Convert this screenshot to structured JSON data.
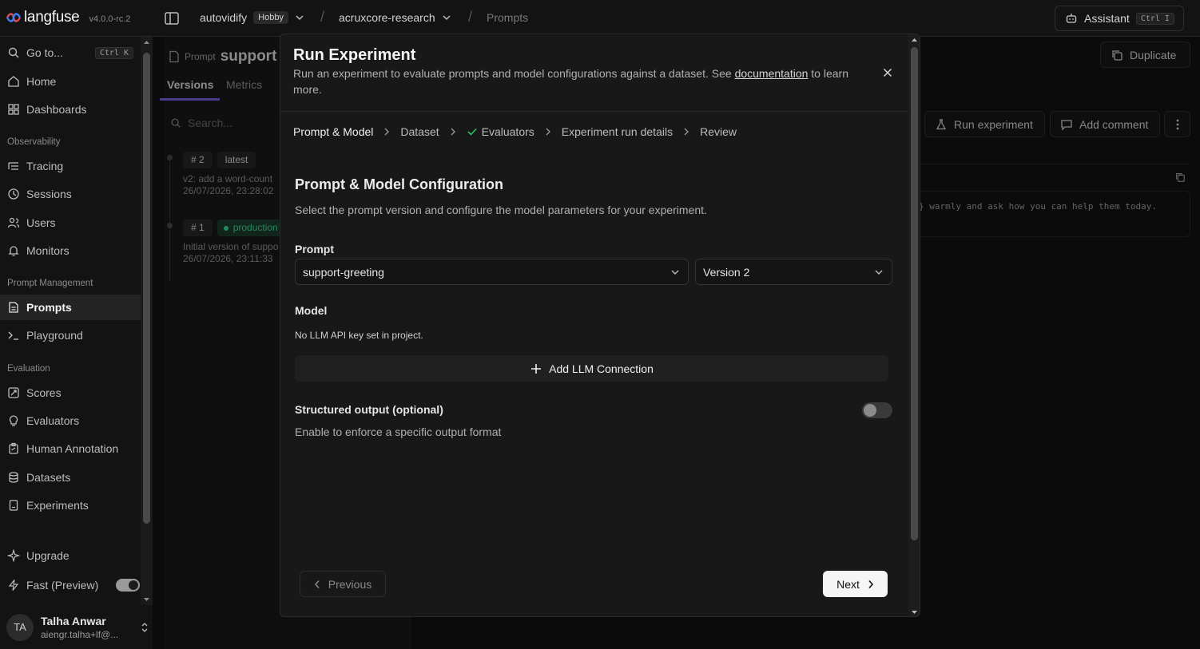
{
  "app": {
    "name": "langfuse",
    "version": "v4.0.0-rc.2"
  },
  "topbar": {
    "org": "autovidify",
    "plan": "Hobby",
    "project": "acruxcore-research",
    "section": "Prompts",
    "assistant_label": "Assistant",
    "assistant_shortcut": "Ctrl I"
  },
  "sidebar": {
    "goto_label": "Go to...",
    "goto_shortcut": "Ctrl K",
    "home": "Home",
    "dashboards": "Dashboards",
    "group_observability": "Observability",
    "tracing": "Tracing",
    "sessions": "Sessions",
    "users": "Users",
    "monitors": "Monitors",
    "group_prompt_mgmt": "Prompt Management",
    "prompts": "Prompts",
    "playground": "Playground",
    "group_evaluation": "Evaluation",
    "scores": "Scores",
    "evaluators": "Evaluators",
    "human_annotation": "Human Annotation",
    "datasets": "Datasets",
    "experiments": "Experiments",
    "upgrade": "Upgrade",
    "fast_preview": "Fast (Preview)",
    "fast_preview_on": true
  },
  "user": {
    "initials": "TA",
    "name": "Talha Anwar",
    "email": "aiengr.talha+lf@..."
  },
  "background": {
    "prompt_kind": "Prompt",
    "prompt_name_partial": "support",
    "tab_versions": "Versions",
    "tab_metrics": "Metrics",
    "search_placeholder": "Search...",
    "duplicate": "Duplicate",
    "run_experiment": "Run experiment",
    "add_comment": "Add comment",
    "versions": [
      {
        "num": "# 2",
        "tag": "latest",
        "desc": "v2: add a word-count",
        "date": "26/07/2026, 23:28:02"
      },
      {
        "num": "# 1",
        "tag": "production",
        "desc": "Initial version of suppo",
        "date": "26/07/2026, 23:11:33"
      }
    ],
    "prompt_text_partial": "} warmly and ask how you can help them today."
  },
  "modal": {
    "title": "Run Experiment",
    "desc_before": "Run an experiment to evaluate prompts and model configurations against a dataset. See ",
    "desc_link": "documentation",
    "desc_after": " to learn more.",
    "steps": [
      "Prompt & Model",
      "Dataset",
      "Evaluators",
      "Experiment run details",
      "Review"
    ],
    "section_title": "Prompt & Model Configuration",
    "section_desc": "Select the prompt version and configure the model parameters for your experiment.",
    "prompt_label": "Prompt",
    "prompt_value": "support-greeting",
    "version_value": "Version 2",
    "model_label": "Model",
    "no_key_text": "No LLM API key set in project.",
    "add_llm": "Add LLM Connection",
    "structured_label": "Structured output (optional)",
    "structured_desc": "Enable to enforce a specific output format",
    "structured_on": false,
    "prev": "Previous",
    "next": "Next"
  }
}
